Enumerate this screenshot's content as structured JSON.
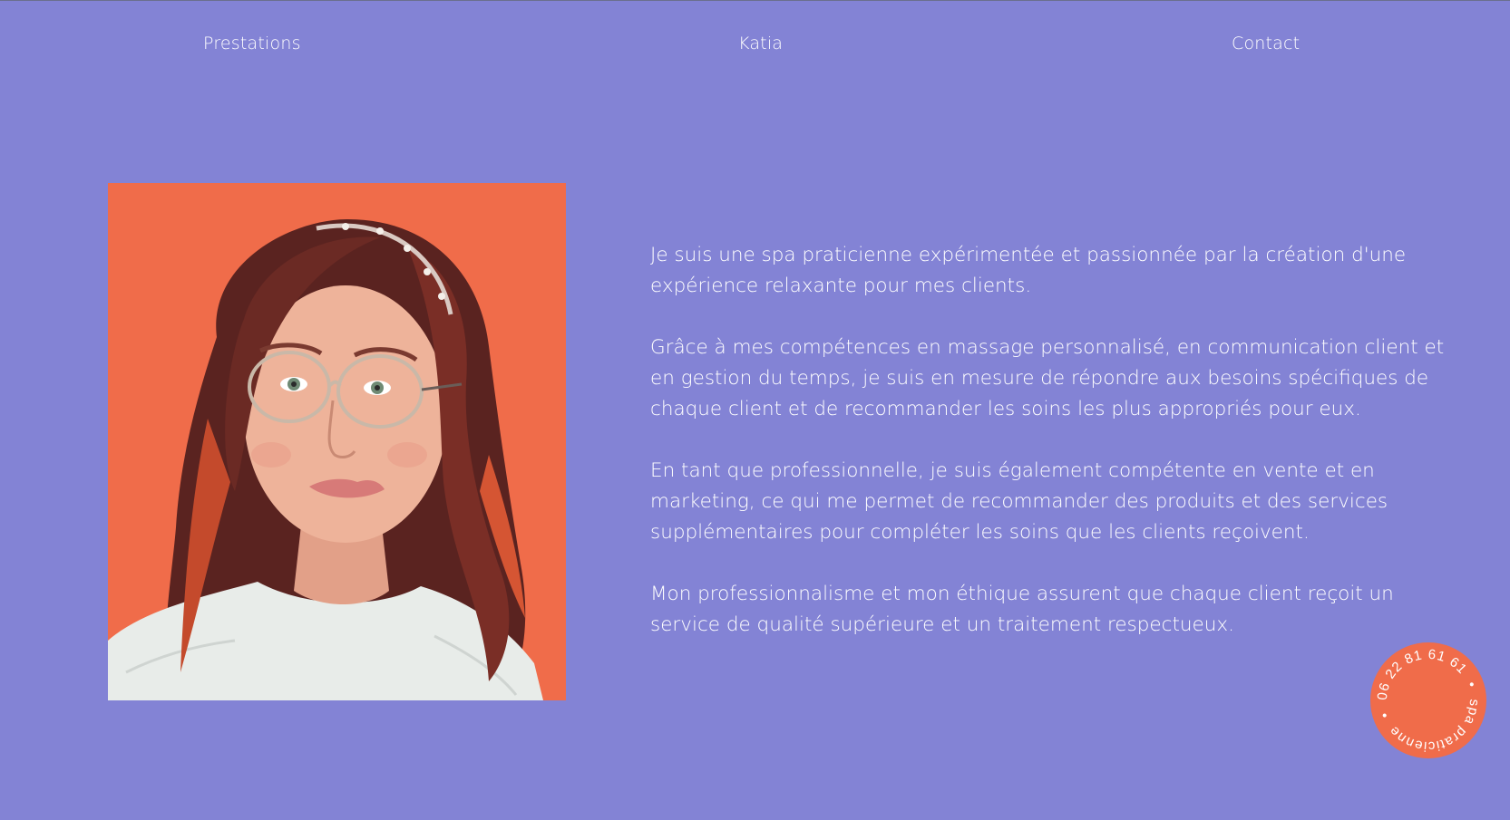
{
  "nav": {
    "prestations": "Prestations",
    "katia": "Katia",
    "contact": "Contact"
  },
  "portrait": {
    "icon": "portrait-photo-icon",
    "background_color": "#f06c4a"
  },
  "bio": {
    "paragraph_1": "Je suis une spa praticienne expérimentée et passionnée par la création d'une expérience relaxante pour mes clients.",
    "paragraph_2": "Grâce à mes compétences en massage personnalisé, en communication client et en gestion du temps, je suis en mesure de répondre aux besoins spécifiques de chaque client et de recommander les soins les plus appropriés pour eux.",
    "paragraph_3": "En tant que professionnelle, je suis également compétente en vente et en marketing, ce qui me permet de recommander des produits et des services supplémentaires pour compléter les soins que les clients reçoivent.",
    "paragraph_4": "Mon professionnalisme et mon éthique assurent que chaque client reçoit un service de qualité supérieure et un traitement respectueux."
  },
  "badge": {
    "phone": "06 22 81 61 61",
    "title": "spa praticienne",
    "separator": "•",
    "color": "#f06c4a"
  },
  "colors": {
    "background": "#8383d5",
    "accent": "#f06c4a",
    "text": "#ffffff"
  }
}
